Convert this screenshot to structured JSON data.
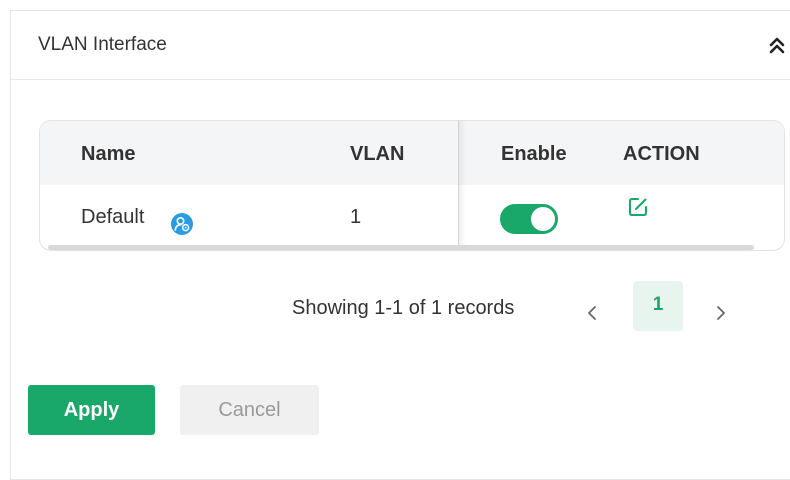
{
  "panel": {
    "title": "VLAN Interface",
    "collapse_icon": "double-chevron-up-icon"
  },
  "table": {
    "columns": [
      "Name",
      "VLAN",
      "Enable",
      "ACTION"
    ],
    "rows": [
      {
        "name": "Default",
        "name_badge_icon": "system-default-badge-icon",
        "vlan": "1",
        "enabled": true,
        "action_icon": "edit-icon"
      }
    ]
  },
  "pagination": {
    "summary": "Showing 1-1 of 1 records",
    "current_page": "1",
    "prev_icon": "chevron-left-icon",
    "next_icon": "chevron-right-icon"
  },
  "buttons": {
    "apply_label": "Apply",
    "cancel_label": "Cancel"
  },
  "colors": {
    "accent": "#1aa86a",
    "info_badge": "#2b9be0",
    "header_bg": "#f4f5f7"
  }
}
